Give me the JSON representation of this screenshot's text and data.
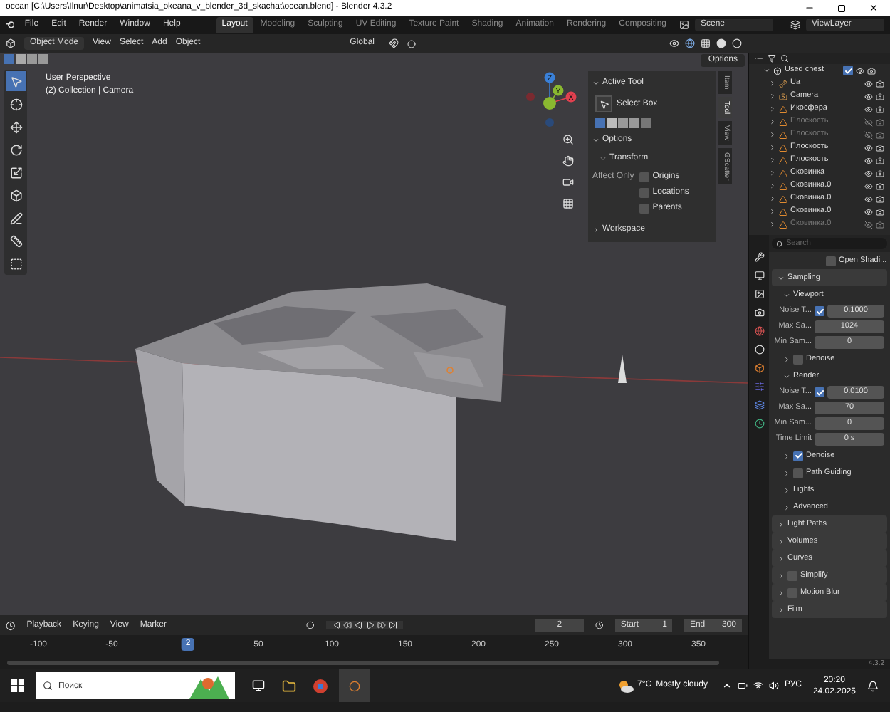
{
  "window": {
    "title": "ocean [C:\\Users\\Ilnur\\Desktop\\animatsia_okeana_v_blender_3d_skachat\\ocean.blend] - Blender 4.3.2"
  },
  "menu": [
    "File",
    "Edit",
    "Render",
    "Window",
    "Help"
  ],
  "workspaces": [
    {
      "label": "Layout",
      "selected": true
    },
    {
      "label": "Modeling",
      "selected": false
    },
    {
      "label": "Sculpting",
      "selected": false
    },
    {
      "label": "UV Editing",
      "selected": false
    },
    {
      "label": "Texture Paint",
      "selected": false
    },
    {
      "label": "Shading",
      "selected": false
    },
    {
      "label": "Animation",
      "selected": false
    },
    {
      "label": "Rendering",
      "selected": false
    },
    {
      "label": "Compositing",
      "selected": false
    }
  ],
  "scene": "Scene",
  "view_layer": "ViewLayer",
  "header": {
    "mode": "Object Mode",
    "menus": [
      "View",
      "Select",
      "Add",
      "Object"
    ],
    "orientation": "Global",
    "options": "Options"
  },
  "viewport": {
    "overlay_lines": [
      "User Perspective",
      "(2) Collection | Camera"
    ],
    "gizmo_axes": [
      "X",
      "Y",
      "Z"
    ]
  },
  "n_panel": {
    "tabs": [
      {
        "label": "Item",
        "selected": false
      },
      {
        "label": "Tool",
        "selected": true
      },
      {
        "label": "View",
        "selected": false
      },
      {
        "label": "GScatter",
        "selected": false
      }
    ],
    "active_tool_heading": "Active Tool",
    "tool": "Select Box",
    "options_heading": "Options",
    "transform_heading": "Transform",
    "affect_only": "Affect Only",
    "affect_options": [
      {
        "label": "Origins",
        "checked": false
      },
      {
        "label": "Locations",
        "checked": false
      },
      {
        "label": "Parents",
        "checked": false
      }
    ],
    "workspace_heading": "Workspace"
  },
  "outliner": {
    "collection": {
      "label": "Used chest",
      "checked": true
    },
    "rows": [
      {
        "label": "Ua",
        "kind": "armature",
        "visible": true
      },
      {
        "label": "Camera",
        "kind": "camera",
        "visible": true
      },
      {
        "label": "Икосфера",
        "kind": "mesh",
        "visible": true
      },
      {
        "label": "Плоскость",
        "kind": "mesh",
        "visible": false
      },
      {
        "label": "Плоскость",
        "kind": "mesh",
        "visible": false
      },
      {
        "label": "Плоскость",
        "kind": "mesh",
        "visible": true
      },
      {
        "label": "Плоскость",
        "kind": "mesh",
        "visible": true
      },
      {
        "label": "Сковинка",
        "kind": "mesh",
        "visible": true
      },
      {
        "label": "Сковинка.0",
        "kind": "mesh",
        "visible": true
      },
      {
        "label": "Сковинка.0",
        "kind": "mesh",
        "visible": true
      },
      {
        "label": "Сковинка.0",
        "kind": "mesh",
        "visible": true
      },
      {
        "label": "Сковинка.0",
        "kind": "mesh",
        "visible": false
      }
    ]
  },
  "properties": {
    "search_placeholder": "Search",
    "rows": [
      {
        "kind": "check",
        "label": "Open Shadi...",
        "checked": false
      },
      {
        "kind": "panel",
        "label": "Sampling",
        "expanded": true
      },
      {
        "kind": "subpanel",
        "label": "Viewport",
        "expanded": true
      },
      {
        "kind": "field",
        "label": "Noise T...",
        "value": "0.1000",
        "checked": true
      },
      {
        "kind": "field",
        "label": "Max Sa...",
        "value": "1024"
      },
      {
        "kind": "field",
        "label": "Min Sam...",
        "value": "0"
      },
      {
        "kind": "subcheck",
        "label": "Denoise",
        "checked": false
      },
      {
        "kind": "subpanel",
        "label": "Render",
        "expanded": true
      },
      {
        "kind": "field",
        "label": "Noise T...",
        "value": "0.0100",
        "checked": true
      },
      {
        "kind": "field",
        "label": "Max Sa...",
        "value": "70"
      },
      {
        "kind": "field",
        "label": "Min Sam...",
        "value": "0"
      },
      {
        "kind": "field",
        "label": "Time Limit",
        "value": "0 s"
      },
      {
        "kind": "subcheck",
        "label": "Denoise",
        "checked": true
      },
      {
        "kind": "subcheck",
        "label": "Path Guiding",
        "checked": false
      },
      {
        "kind": "subpanel",
        "label": "Lights",
        "expanded": false
      },
      {
        "kind": "subpanel",
        "label": "Advanced",
        "expanded": false
      },
      {
        "kind": "panel",
        "label": "Light Paths",
        "expanded": false
      },
      {
        "kind": "panel",
        "label": "Volumes",
        "expanded": false
      },
      {
        "kind": "panel",
        "label": "Curves",
        "expanded": false
      },
      {
        "kind": "panelcheck",
        "label": "Simplify",
        "checked": false
      },
      {
        "kind": "panelcheck",
        "label": "Motion Blur",
        "checked": false
      },
      {
        "kind": "panel",
        "label": "Film",
        "expanded": false
      }
    ]
  },
  "timeline": {
    "menus": [
      "Playback",
      "Keying",
      "View",
      "Marker"
    ],
    "current_frame": "2",
    "start_label": "Start",
    "start": "1",
    "end_label": "End",
    "end": "300",
    "ticks": [
      "-100",
      "-50",
      "50",
      "100",
      "150",
      "200",
      "250",
      "300",
      "350"
    ],
    "playhead": "2"
  },
  "version": "4.3.2",
  "taskbar": {
    "search_placeholder": "Поиск",
    "temperature": "7°C",
    "weather": "Mostly cloudy",
    "language": "РУС",
    "time": "20:20",
    "date": "24.02.2025"
  }
}
